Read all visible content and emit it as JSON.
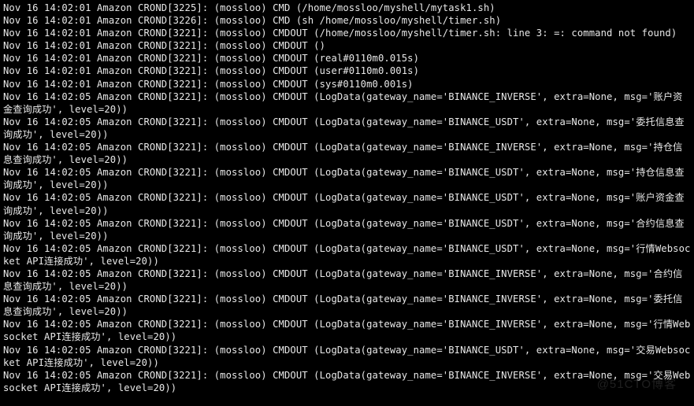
{
  "watermark": "@51CTO博客",
  "lines": [
    "Nov 16 14:02:01 Amazon CROND[3225]: (mossloo) CMD (/home/mossloo/myshell/mytask1.sh)",
    "Nov 16 14:02:01 Amazon CROND[3226]: (mossloo) CMD (sh /home/mossloo/myshell/timer.sh)",
    "Nov 16 14:02:01 Amazon CROND[3221]: (mossloo) CMDOUT (/home/mossloo/myshell/timer.sh: line 3: =: command not found)",
    "Nov 16 14:02:01 Amazon CROND[3221]: (mossloo) CMDOUT ()",
    "Nov 16 14:02:01 Amazon CROND[3221]: (mossloo) CMDOUT (real#0110m0.015s)",
    "Nov 16 14:02:01 Amazon CROND[3221]: (mossloo) CMDOUT (user#0110m0.001s)",
    "Nov 16 14:02:01 Amazon CROND[3221]: (mossloo) CMDOUT (sys#0110m0.001s)",
    "Nov 16 14:02:05 Amazon CROND[3221]: (mossloo) CMDOUT (LogData(gateway_name='BINANCE_INVERSE', extra=None, msg='账户资金查询成功', level=20))",
    "Nov 16 14:02:05 Amazon CROND[3221]: (mossloo) CMDOUT (LogData(gateway_name='BINANCE_USDT', extra=None, msg='委托信息查询成功', level=20))",
    "Nov 16 14:02:05 Amazon CROND[3221]: (mossloo) CMDOUT (LogData(gateway_name='BINANCE_INVERSE', extra=None, msg='持仓信息查询成功', level=20))",
    "Nov 16 14:02:05 Amazon CROND[3221]: (mossloo) CMDOUT (LogData(gateway_name='BINANCE_USDT', extra=None, msg='持仓信息查询成功', level=20))",
    "Nov 16 14:02:05 Amazon CROND[3221]: (mossloo) CMDOUT (LogData(gateway_name='BINANCE_USDT', extra=None, msg='账户资金查询成功', level=20))",
    "Nov 16 14:02:05 Amazon CROND[3221]: (mossloo) CMDOUT (LogData(gateway_name='BINANCE_USDT', extra=None, msg='合约信息查询成功', level=20))",
    "Nov 16 14:02:05 Amazon CROND[3221]: (mossloo) CMDOUT (LogData(gateway_name='BINANCE_USDT', extra=None, msg='行情Websocket API连接成功', level=20))",
    "Nov 16 14:02:05 Amazon CROND[3221]: (mossloo) CMDOUT (LogData(gateway_name='BINANCE_INVERSE', extra=None, msg='合约信息查询成功', level=20))",
    "Nov 16 14:02:05 Amazon CROND[3221]: (mossloo) CMDOUT (LogData(gateway_name='BINANCE_INVERSE', extra=None, msg='委托信息查询成功', level=20))",
    "Nov 16 14:02:05 Amazon CROND[3221]: (mossloo) CMDOUT (LogData(gateway_name='BINANCE_INVERSE', extra=None, msg='行情Websocket API连接成功', level=20))",
    "Nov 16 14:02:05 Amazon CROND[3221]: (mossloo) CMDOUT (LogData(gateway_name='BINANCE_USDT', extra=None, msg='交易Websocket API连接成功', level=20))",
    "Nov 16 14:02:05 Amazon CROND[3221]: (mossloo) CMDOUT (LogData(gateway_name='BINANCE_INVERSE', extra=None, msg='交易Websocket API连接成功', level=20))"
  ]
}
